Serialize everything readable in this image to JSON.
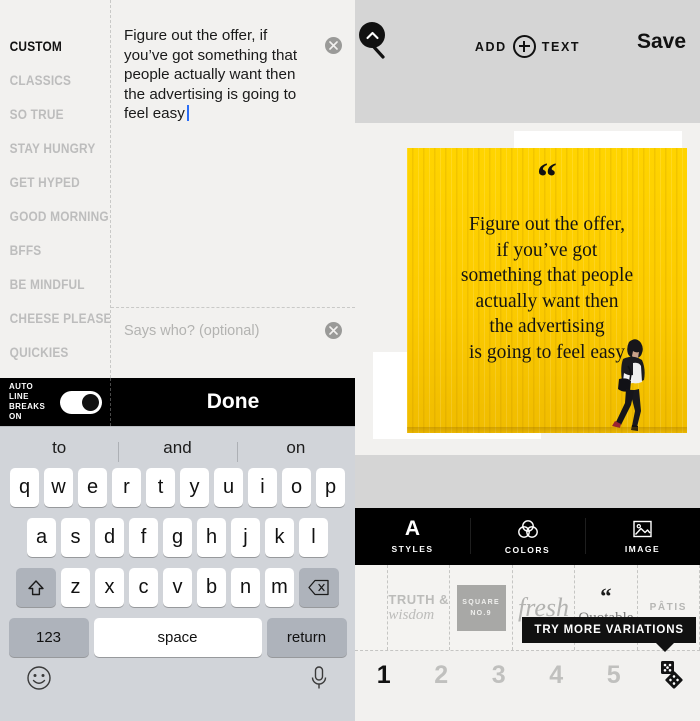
{
  "left": {
    "categories": [
      {
        "label": "CUSTOM",
        "active": true
      },
      {
        "label": "CLASSICS",
        "active": false
      },
      {
        "label": "SO TRUE",
        "active": false
      },
      {
        "label": "STAY HUNGRY",
        "active": false
      },
      {
        "label": "GET HYPED",
        "active": false
      },
      {
        "label": "GOOD MORNING",
        "active": false
      },
      {
        "label": "BFFS",
        "active": false
      },
      {
        "label": "BE MINDFUL",
        "active": false
      },
      {
        "label": "CHEESE PLEASE",
        "active": false
      },
      {
        "label": "QUICKIES",
        "active": false
      }
    ],
    "quote_value": "Figure out the offer, if you’ve got something that people actually want then the advertising is going to feel easy",
    "attribution_placeholder": "Says who? (optional)",
    "toggle_label": "AUTO LINE BREAKS ON",
    "toggle_state": "on",
    "done_label": "Done"
  },
  "keyboard": {
    "suggestions": [
      "to",
      "and",
      "on"
    ],
    "row1": [
      "q",
      "w",
      "e",
      "r",
      "t",
      "y",
      "u",
      "i",
      "o",
      "p"
    ],
    "row2": [
      "a",
      "s",
      "d",
      "f",
      "g",
      "h",
      "j",
      "k",
      "l"
    ],
    "row3": [
      "z",
      "x",
      "c",
      "v",
      "b",
      "n",
      "m"
    ],
    "shift_icon": "shift-icon",
    "backspace_icon": "backspace-icon",
    "numbers_label": "123",
    "space_label": "space",
    "return_label": "return",
    "emoji_icon": "emoji-icon",
    "mic_icon": "microphone-icon"
  },
  "right": {
    "header": {
      "back_icon": "back-chevron-icon",
      "add_label": "ADD",
      "text_label": "TEXT",
      "plus_icon": "plus-circle-icon",
      "save_label": "Save"
    },
    "card": {
      "quote_mark": "“",
      "quote_lines": "Figure out the offer,\nif you’ve got\nsomething that people\nactually want then\nthe advertising\nis going to feel easy",
      "background_color": "#ffd100",
      "photo": "woman-walking-photo"
    },
    "toolbar": [
      {
        "label": "STYLES",
        "icon": "letter-a-icon",
        "active": true
      },
      {
        "label": "COLORS",
        "icon": "venn-circles-icon",
        "active": false
      },
      {
        "label": "IMAGE",
        "icon": "picture-icon",
        "active": false
      }
    ],
    "collapse_icon": "chevron-up-icon",
    "thumbnails": [
      {
        "name": "truth-and-wisdom",
        "line1": "TRUTH &",
        "line2": "wisdom"
      },
      {
        "name": "square-no-9",
        "line1": "SQUARE",
        "line2": "NO.9"
      },
      {
        "name": "fresh",
        "line1": "fresh",
        "line2": ""
      },
      {
        "name": "quotable",
        "line1": "“",
        "line2": "Quotable"
      },
      {
        "name": "patisserie",
        "line1": "PÂTIS",
        "line2": ""
      }
    ],
    "tooltip": "TRY MORE VARIATIONS",
    "variations": [
      {
        "label": "1",
        "active": true
      },
      {
        "label": "2",
        "active": false
      },
      {
        "label": "3",
        "active": false
      },
      {
        "label": "4",
        "active": false
      },
      {
        "label": "5",
        "active": false
      }
    ],
    "dice_icon": "dice-shuffle-icon"
  }
}
